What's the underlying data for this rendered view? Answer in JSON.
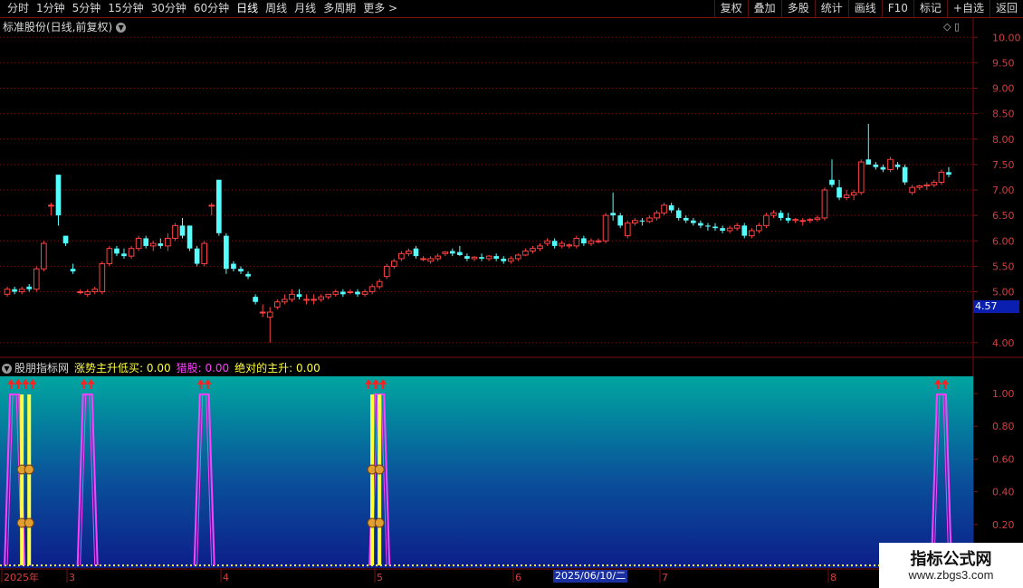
{
  "toolbar": {
    "left": [
      "分时",
      "1分钟",
      "5分钟",
      "15分钟",
      "30分钟",
      "60分钟",
      "日线",
      "周线",
      "月线",
      "多周期",
      "更多 >"
    ],
    "active": "日线",
    "right": [
      "复权",
      "叠加",
      "多股",
      "统计",
      "画线",
      "F10",
      "标记",
      "+自选",
      "返回"
    ]
  },
  "main_chart": {
    "title": "标准股份(日线,前复权)",
    "y_ticks": [
      "10.00",
      "9.50",
      "9.00",
      "8.50",
      "8.00",
      "7.50",
      "7.00",
      "6.50",
      "6.00",
      "5.50",
      "5.00",
      "4.00"
    ],
    "current_price": "4.57",
    "colors": {
      "up": "#ff4040",
      "down": "#54ffff",
      "grid": "#7a1010"
    }
  },
  "indicator": {
    "name": "股朋指标网",
    "s1_label": "涨势主升低买: 0.00",
    "s2_label": "猎股: 0.00",
    "s3_label": "绝对的主升: 0.00",
    "y_ticks": [
      "1.00",
      "0.80",
      "0.60",
      "0.40",
      "0.20"
    ]
  },
  "x_axis": {
    "labels": [
      "2025年",
      "3",
      "4",
      "5",
      "6",
      "7",
      "8"
    ],
    "cursor_date": "2025/06/10/二"
  },
  "watermark": {
    "title": "指标公式网",
    "url": "www.zbgs3.com"
  },
  "chart_data": {
    "type": "candlestick",
    "ylim": [
      3.8,
      10.2
    ],
    "candles": [
      [
        4.95,
        5.1,
        4.9,
        5.05
      ],
      [
        5.05,
        5.1,
        4.95,
        5.0
      ],
      [
        5.0,
        5.1,
        4.95,
        5.05
      ],
      [
        5.1,
        5.15,
        5.0,
        5.05
      ],
      [
        5.05,
        5.5,
        5.0,
        5.45
      ],
      [
        5.45,
        6.0,
        5.4,
        5.95
      ],
      [
        6.7,
        6.75,
        6.5,
        6.7
      ],
      [
        7.3,
        7.3,
        6.3,
        6.5
      ],
      [
        6.1,
        6.1,
        5.9,
        5.95
      ],
      [
        5.45,
        5.55,
        5.35,
        5.4
      ],
      [
        5.0,
        5.05,
        4.95,
        5.0
      ],
      [
        4.95,
        5.05,
        4.9,
        5.0
      ],
      [
        5.0,
        5.1,
        4.95,
        5.05
      ],
      [
        5.0,
        5.6,
        4.95,
        5.55
      ],
      [
        5.55,
        5.9,
        5.5,
        5.85
      ],
      [
        5.85,
        5.9,
        5.7,
        5.75
      ],
      [
        5.75,
        5.85,
        5.65,
        5.7
      ],
      [
        5.7,
        5.9,
        5.65,
        5.85
      ],
      [
        5.85,
        6.1,
        5.8,
        6.05
      ],
      [
        6.05,
        6.1,
        5.85,
        5.9
      ],
      [
        5.9,
        6.0,
        5.8,
        5.95
      ],
      [
        5.95,
        6.05,
        5.85,
        5.9
      ],
      [
        5.9,
        6.15,
        5.8,
        6.05
      ],
      [
        6.05,
        6.35,
        6.0,
        6.3
      ],
      [
        6.3,
        6.45,
        6.05,
        6.1
      ],
      [
        6.3,
        6.3,
        5.8,
        5.85
      ],
      [
        5.85,
        5.9,
        5.5,
        5.55
      ],
      [
        5.55,
        6.0,
        5.5,
        5.95
      ],
      [
        6.7,
        6.75,
        6.5,
        6.7
      ],
      [
        7.2,
        7.2,
        6.1,
        6.15
      ],
      [
        6.1,
        6.15,
        5.35,
        5.45
      ],
      [
        5.55,
        5.6,
        5.4,
        5.45
      ],
      [
        5.45,
        5.5,
        5.35,
        5.4
      ],
      [
        5.35,
        5.4,
        5.25,
        5.3
      ],
      [
        4.9,
        4.95,
        4.75,
        4.8
      ],
      [
        4.6,
        4.75,
        4.5,
        4.6
      ],
      [
        4.5,
        4.7,
        4.0,
        4.6
      ],
      [
        4.7,
        4.85,
        4.65,
        4.8
      ],
      [
        4.8,
        4.95,
        4.75,
        4.85
      ],
      [
        4.85,
        5.05,
        4.8,
        4.95
      ],
      [
        4.95,
        5.05,
        4.85,
        4.9
      ],
      [
        4.85,
        4.95,
        4.75,
        4.85
      ],
      [
        4.85,
        4.95,
        4.75,
        4.85
      ],
      [
        4.85,
        4.95,
        4.8,
        4.9
      ],
      [
        4.9,
        4.95,
        4.85,
        4.95
      ],
      [
        4.95,
        5.05,
        4.9,
        5.0
      ],
      [
        5.0,
        5.05,
        4.9,
        4.95
      ],
      [
        5.0,
        5.05,
        4.95,
        5.0
      ],
      [
        5.0,
        5.05,
        4.9,
        4.95
      ],
      [
        4.95,
        5.05,
        4.9,
        5.0
      ],
      [
        5.0,
        5.15,
        4.95,
        5.1
      ],
      [
        5.1,
        5.25,
        5.05,
        5.2
      ],
      [
        5.3,
        5.55,
        5.25,
        5.5
      ],
      [
        5.5,
        5.65,
        5.45,
        5.6
      ],
      [
        5.65,
        5.8,
        5.6,
        5.75
      ],
      [
        5.75,
        5.85,
        5.7,
        5.8
      ],
      [
        5.85,
        5.9,
        5.65,
        5.7
      ],
      [
        5.65,
        5.7,
        5.6,
        5.65
      ],
      [
        5.6,
        5.7,
        5.55,
        5.65
      ],
      [
        5.65,
        5.75,
        5.6,
        5.7
      ],
      [
        5.75,
        5.8,
        5.7,
        5.78
      ],
      [
        5.8,
        5.85,
        5.7,
        5.75
      ],
      [
        5.78,
        5.9,
        5.7,
        5.72
      ],
      [
        5.7,
        5.75,
        5.6,
        5.65
      ],
      [
        5.65,
        5.7,
        5.6,
        5.68
      ],
      [
        5.68,
        5.75,
        5.6,
        5.65
      ],
      [
        5.65,
        5.72,
        5.6,
        5.7
      ],
      [
        5.7,
        5.75,
        5.6,
        5.65
      ],
      [
        5.65,
        5.7,
        5.55,
        5.6
      ],
      [
        5.6,
        5.7,
        5.55,
        5.65
      ],
      [
        5.65,
        5.75,
        5.6,
        5.72
      ],
      [
        5.72,
        5.85,
        5.7,
        5.8
      ],
      [
        5.8,
        5.9,
        5.75,
        5.85
      ],
      [
        5.85,
        5.95,
        5.8,
        5.9
      ],
      [
        5.95,
        6.05,
        5.9,
        6.0
      ],
      [
        6.0,
        6.05,
        5.85,
        5.9
      ],
      [
        5.9,
        6.0,
        5.85,
        5.95
      ],
      [
        5.9,
        5.95,
        5.85,
        5.92
      ],
      [
        5.9,
        6.1,
        5.85,
        6.05
      ],
      [
        6.05,
        6.1,
        5.9,
        5.95
      ],
      [
        5.95,
        6.05,
        5.9,
        6.0
      ],
      [
        6.0,
        6.05,
        5.95,
        6.0
      ],
      [
        6.0,
        6.55,
        5.95,
        6.5
      ],
      [
        6.55,
        6.95,
        6.4,
        6.5
      ],
      [
        6.5,
        6.55,
        6.25,
        6.3
      ],
      [
        6.1,
        6.4,
        6.05,
        6.35
      ],
      [
        6.35,
        6.45,
        6.3,
        6.4
      ],
      [
        6.4,
        6.45,
        6.3,
        6.38
      ],
      [
        6.38,
        6.5,
        6.35,
        6.45
      ],
      [
        6.45,
        6.6,
        6.4,
        6.55
      ],
      [
        6.55,
        6.75,
        6.5,
        6.7
      ],
      [
        6.7,
        6.75,
        6.55,
        6.6
      ],
      [
        6.6,
        6.65,
        6.4,
        6.45
      ],
      [
        6.45,
        6.5,
        6.35,
        6.4
      ],
      [
        6.4,
        6.45,
        6.3,
        6.35
      ],
      [
        6.35,
        6.4,
        6.25,
        6.3
      ],
      [
        6.3,
        6.35,
        6.2,
        6.28
      ],
      [
        6.28,
        6.35,
        6.2,
        6.25
      ],
      [
        6.25,
        6.3,
        6.15,
        6.2
      ],
      [
        6.2,
        6.3,
        6.15,
        6.25
      ],
      [
        6.25,
        6.35,
        6.2,
        6.3
      ],
      [
        6.3,
        6.35,
        6.05,
        6.1
      ],
      [
        6.1,
        6.25,
        6.05,
        6.2
      ],
      [
        6.2,
        6.35,
        6.15,
        6.3
      ],
      [
        6.3,
        6.55,
        6.25,
        6.5
      ],
      [
        6.5,
        6.6,
        6.45,
        6.55
      ],
      [
        6.55,
        6.6,
        6.4,
        6.45
      ],
      [
        6.45,
        6.55,
        6.35,
        6.4
      ],
      [
        6.4,
        6.45,
        6.35,
        6.42
      ],
      [
        6.4,
        6.45,
        6.3,
        6.4
      ],
      [
        6.4,
        6.45,
        6.35,
        6.42
      ],
      [
        6.42,
        6.5,
        6.38,
        6.45
      ],
      [
        6.45,
        7.05,
        6.4,
        7.0
      ],
      [
        7.2,
        7.6,
        7.05,
        7.1
      ],
      [
        7.05,
        7.2,
        6.8,
        6.85
      ],
      [
        6.85,
        7.0,
        6.8,
        6.9
      ],
      [
        6.9,
        7.0,
        6.8,
        6.95
      ],
      [
        6.95,
        7.6,
        6.9,
        7.55
      ],
      [
        7.6,
        8.3,
        7.55,
        7.5
      ],
      [
        7.5,
        7.55,
        7.4,
        7.45
      ],
      [
        7.45,
        7.5,
        7.35,
        7.4
      ],
      [
        7.4,
        7.65,
        7.35,
        7.6
      ],
      [
        7.5,
        7.55,
        7.4,
        7.45
      ],
      [
        7.45,
        7.5,
        7.1,
        7.15
      ],
      [
        6.95,
        7.1,
        6.9,
        7.05
      ],
      [
        7.05,
        7.1,
        7.0,
        7.08
      ],
      [
        7.08,
        7.15,
        7.0,
        7.1
      ],
      [
        7.1,
        7.2,
        7.05,
        7.15
      ],
      [
        7.15,
        7.4,
        7.1,
        7.35
      ],
      [
        7.35,
        7.45,
        7.25,
        7.3
      ]
    ],
    "indicator_series": {
      "s2_peaks_index": [
        1,
        11,
        27,
        51,
        128
      ],
      "s1_bars_index": [
        2,
        3,
        50,
        51
      ]
    }
  }
}
